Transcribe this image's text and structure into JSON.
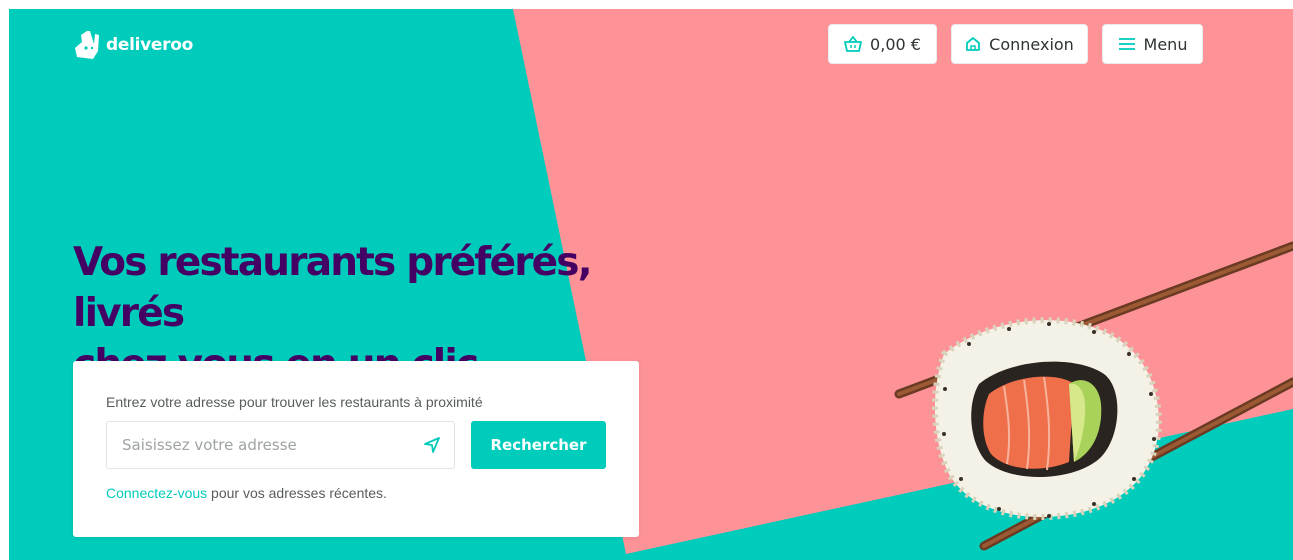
{
  "brand": {
    "name": "deliveroo"
  },
  "header": {
    "basket_label": "0,00 €",
    "login_label": "Connexion",
    "menu_label": "Menu"
  },
  "hero": {
    "headline_line1": "Vos restaurants préférés, livrés",
    "headline_line2": "chez vous en un clic"
  },
  "search": {
    "label": "Entrez votre adresse pour trouver les restaurants à proximité",
    "placeholder": "Saisissez votre adresse",
    "button_label": "Rechercher",
    "signin_link": "Connectez-vous",
    "signin_suffix": " pour vos adresses récentes."
  },
  "icons": {
    "logo": "kangaroo-logo-icon",
    "basket": "basket-icon",
    "login": "home-icon",
    "menu": "hamburger-menu-icon",
    "locate": "location-arrow-icon"
  },
  "colors": {
    "teal": "#00ccbc",
    "pink": "#fd9297",
    "headline": "#440063"
  }
}
